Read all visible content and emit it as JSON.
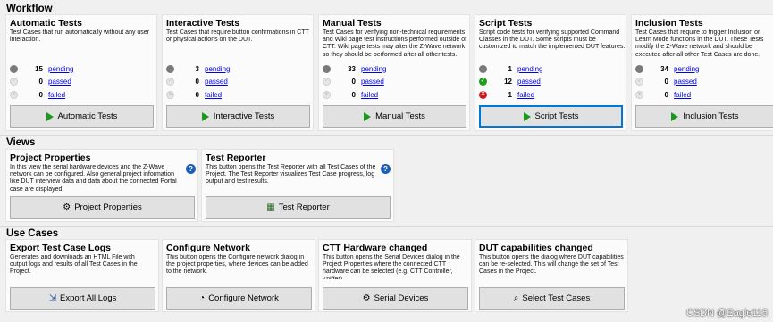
{
  "workflow": {
    "title": "Workflow",
    "cards": [
      {
        "title": "Automatic Tests",
        "desc": "Test Cases that run automatically without any user interaction.",
        "stats": [
          {
            "count": "15",
            "label": "pending",
            "state": "grey"
          },
          {
            "count": "0",
            "label": "passed",
            "state": "lgrey"
          },
          {
            "count": "0",
            "label": "failed",
            "state": "lgrey"
          }
        ],
        "button": "Automatic Tests",
        "icon": "play-icon"
      },
      {
        "title": "Interactive Tests",
        "desc": "Test Cases that require button confirmations in CTT or physical actions on the DUT.",
        "stats": [
          {
            "count": "3",
            "label": "pending",
            "state": "grey"
          },
          {
            "count": "0",
            "label": "passed",
            "state": "lgrey"
          },
          {
            "count": "0",
            "label": "failed",
            "state": "lgrey"
          }
        ],
        "button": "Interactive Tests",
        "icon": "play-icon"
      },
      {
        "title": "Manual Tests",
        "desc": "Test Cases for verifying non-technical requirements and Wiki page test instructions performed outside of CTT. Wiki page tests may alter the Z-Wave network so they should be performed after all other tests.",
        "stats": [
          {
            "count": "33",
            "label": "pending",
            "state": "grey"
          },
          {
            "count": "0",
            "label": "passed",
            "state": "lgrey"
          },
          {
            "count": "0",
            "label": "failed",
            "state": "lgrey"
          }
        ],
        "button": "Manual Tests",
        "icon": "play-icon"
      },
      {
        "title": "Script Tests",
        "desc": "Script code tests for verifying supported Command Classes in the DUT. Some scripts must be customized to match the implemented DUT features.",
        "stats": [
          {
            "count": "1",
            "label": "pending",
            "state": "grey"
          },
          {
            "count": "12",
            "label": "passed",
            "state": "green"
          },
          {
            "count": "1",
            "label": "failed",
            "state": "red"
          }
        ],
        "button": "Script Tests",
        "icon": "play-icon"
      },
      {
        "title": "Inclusion Tests",
        "desc": "Test Cases that require to trigger Inclusion or Learn Mode functions in the DUT. These Tests modify the Z-Wave network and should be executed after all other Test Cases are done.",
        "stats": [
          {
            "count": "34",
            "label": "pending",
            "state": "grey"
          },
          {
            "count": "0",
            "label": "passed",
            "state": "lgrey"
          },
          {
            "count": "0",
            "label": "failed",
            "state": "lgrey"
          }
        ],
        "button": "Inclusion Tests",
        "icon": "play-icon"
      }
    ]
  },
  "views": {
    "title": "Views",
    "cards": [
      {
        "title": "Project Properties",
        "desc": "In this view the serial hardware devices and the Z-Wave network can be configured. Also general project information like DUT interview data and data about the connected Portal case are displayed.",
        "button": "Project Properties",
        "icon": "gear-icon"
      },
      {
        "title": "Test Reporter",
        "desc": "This button opens the Test Reporter with all Test Cases of the Project. The Test Reporter visualizes Test Case progress, log output and test results.",
        "button": "Test Reporter",
        "icon": "calendar-icon"
      }
    ]
  },
  "use_cases": {
    "title": "Use Cases",
    "cards": [
      {
        "title": "Export Test Case Logs",
        "desc": "Generates and downloads an HTML File with output logs and results of all Test Cases in the Project.",
        "button": "Export All Logs",
        "icon": "export-icon"
      },
      {
        "title": "Configure Network",
        "desc": "This button opens the Configure network dialog in the project properties, where devices can be added to the network.",
        "button": "Configure Network",
        "icon": "network-icon"
      },
      {
        "title": "CTT Hardware changed",
        "desc": "This button opens the Serial Devices dialog in the Project Properties where the connected CTT hardware can be selected (e.g. CTT Controller, Zniffer).",
        "button": "Serial Devices",
        "icon": "gears-icon"
      },
      {
        "title": "DUT capabilities changed",
        "desc": "This button opens the dialog where DUT capabilities can be re-selected. This will change the set of Test Cases in the Project.",
        "button": "Select Test Cases",
        "icon": "magnifier-icon"
      }
    ]
  },
  "watermark": "CSDN @Eagle115"
}
